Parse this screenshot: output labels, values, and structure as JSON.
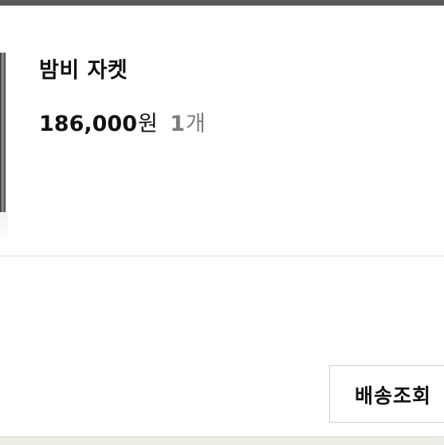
{
  "product": {
    "name": "밤비 자켓",
    "price": "186,000",
    "price_unit": "원",
    "quantity": "1",
    "quantity_unit": "개"
  },
  "actions": {
    "tracking_label": "배송조회"
  }
}
